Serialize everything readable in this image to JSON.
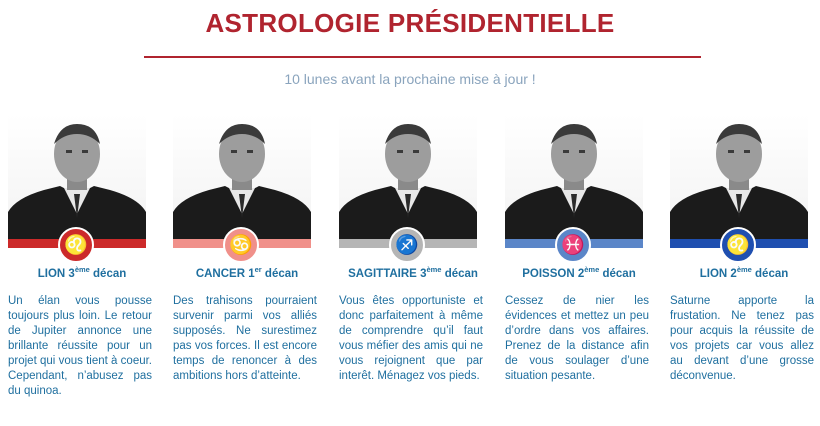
{
  "title": "ASTROLOGIE PRÉSIDENTIELLE",
  "subtitle": "10 lunes avant la prochaine mise à jour !",
  "colors": {
    "title": "#b0242f",
    "text": "#1f6f9f",
    "subtitle": "#8aa4bd"
  },
  "cards": [
    {
      "sign": "LION",
      "ordinal": "3",
      "ordinal_suffix": "ème",
      "decan": "décan",
      "text": "Un élan vous pousse toujours plus loin. Le retour de Jupiter annonce une brillante réussite pour un projet qui vous tient à coeur. Cependant, n’abusez pas du quinoa.",
      "color": "#cc2a2a",
      "icon": "lion-zodiac-icon",
      "glyph": "♌"
    },
    {
      "sign": "CANCER",
      "ordinal": "1",
      "ordinal_suffix": "er",
      "decan": "décan",
      "text": "Des trahisons pourraient survenir parmi vos alliés supposés. Ne surestimez pas vos forces. Il est encore temps de renoncer à des ambitions hors d’atteinte.",
      "color": "#f0908a",
      "icon": "cancer-zodiac-icon",
      "glyph": "♋"
    },
    {
      "sign": "SAGITTAIRE",
      "ordinal": "3",
      "ordinal_suffix": "ème",
      "decan": "décan",
      "text": "Vous êtes opportuniste et donc parfaitement à même de comprendre qu’il faut vous méfier des amis qui ne vous rejoignent que par interêt. Ménagez vos pieds.",
      "color": "#b5b5b5",
      "icon": "sagittarius-zodiac-icon",
      "glyph": "♐"
    },
    {
      "sign": "POISSON",
      "ordinal": "2",
      "ordinal_suffix": "ème",
      "decan": "décan",
      "text": "Cessez de nier les évidences et mettez un peu d’ordre dans vos affaires. Prenez de la distance afin de vous soulager d’une situation pesante.",
      "color": "#5b86c8",
      "icon": "pisces-zodiac-icon",
      "glyph": "♓"
    },
    {
      "sign": "LION",
      "ordinal": "2",
      "ordinal_suffix": "ème",
      "decan": "décan",
      "text": "Saturne apporte la frustation. Ne tenez pas pour acquis la réussite de vos projets car vous allez au devant d’une grosse déconvenue.",
      "color": "#1f4fb0",
      "icon": "lion-zodiac-icon",
      "glyph": "♌"
    }
  ]
}
